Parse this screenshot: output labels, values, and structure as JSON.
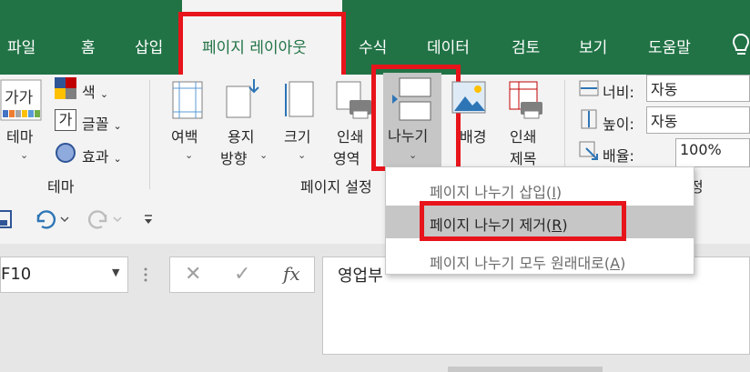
{
  "tabs": [
    {
      "label": "파일"
    },
    {
      "label": "홈"
    },
    {
      "label": "삽입"
    },
    {
      "label": "페이지 레이아웃"
    },
    {
      "label": "수식"
    },
    {
      "label": "데이터"
    },
    {
      "label": "검토"
    },
    {
      "label": "보기"
    },
    {
      "label": "도움말"
    }
  ],
  "ribbon": {
    "theme_big_icon": "가가",
    "theme_label": "테마",
    "theme_colors": "색",
    "theme_fonts": "글꼴",
    "theme_fonts_icon": "가",
    "theme_effects": "효과",
    "margins": [
      "여백"
    ],
    "orientation": [
      "용지",
      "방향"
    ],
    "size": [
      "크기"
    ],
    "print_area": [
      "인쇄",
      "영역"
    ],
    "breaks": [
      "나누기"
    ],
    "background": [
      "배경"
    ],
    "print_titles": [
      "인쇄",
      "제목"
    ],
    "width_label": "너비:",
    "width_value": "자동",
    "height_label": "높이:",
    "height_value": "자동",
    "scale_label": "배율:",
    "scale_value": "100%",
    "group_theme": "테마",
    "group_page_setup": "페이지 설정",
    "group_scale_tail": "정"
  },
  "menu": {
    "insert_break": {
      "text": "페이지 나누기 삽입(",
      "key": "I",
      "close": ")"
    },
    "remove_break": {
      "text": "페이지 나누기 제거(",
      "key": "R",
      "close": ")"
    },
    "reset_all": {
      "text": "페이지 나누기 모두 원래대로(",
      "key": "A",
      "close": ")"
    }
  },
  "namebox": {
    "value": "F10"
  },
  "formula": {
    "cancel": "✕",
    "enter": "✓",
    "fx": "fx",
    "content": "영업부"
  },
  "icons": [
    "save-icon",
    "undo-icon",
    "redo-icon",
    "customize-qat-icon",
    "lightbulb-icon"
  ],
  "colors": {
    "excel_green": "#217346",
    "highlight_red": "#e8141b",
    "menu_hover": "#c6c6c6"
  }
}
